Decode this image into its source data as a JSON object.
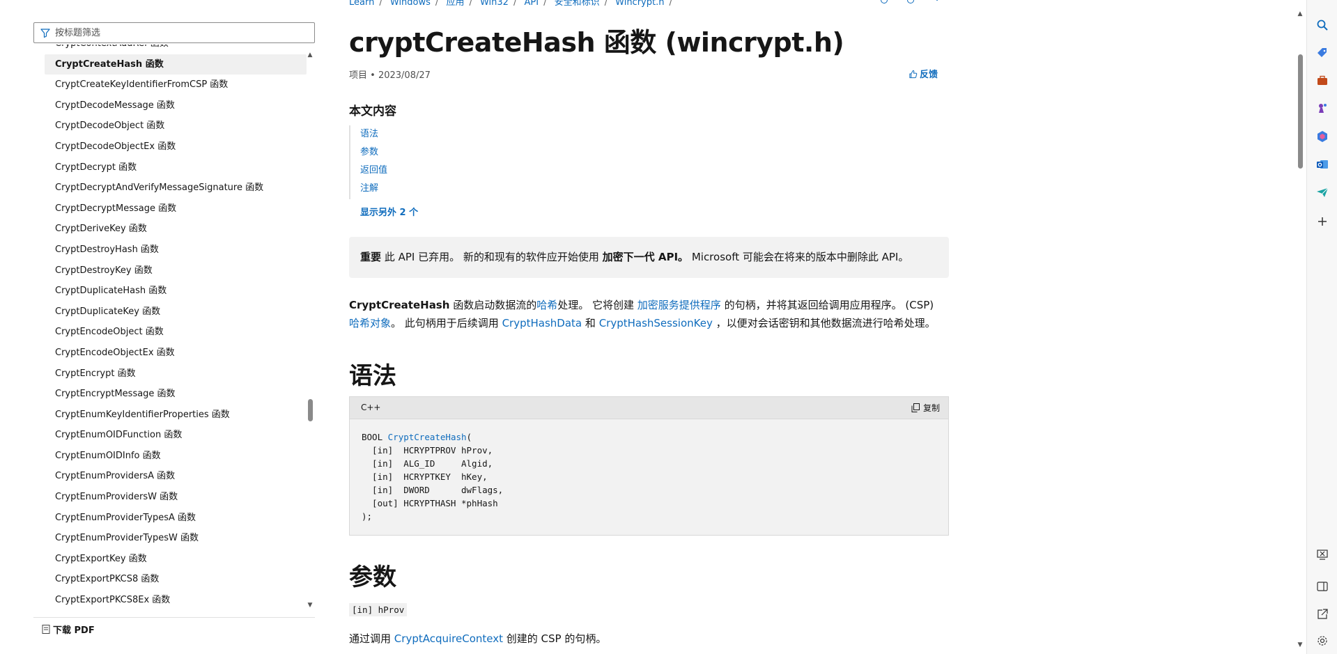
{
  "filter": {
    "placeholder": "按标题筛选"
  },
  "toc_items": [
    "CryptContextAddRef 函数",
    "CryptCreateHash 函数",
    "CryptCreateKeyIdentifierFromCSP 函数",
    "CryptDecodeMessage 函数",
    "CryptDecodeObject 函数",
    "CryptDecodeObjectEx 函数",
    "CryptDecrypt 函数",
    "CryptDecryptAndVerifyMessageSignature 函数",
    "CryptDecryptMessage 函数",
    "CryptDeriveKey 函数",
    "CryptDestroyHash 函数",
    "CryptDestroyKey 函数",
    "CryptDuplicateHash 函数",
    "CryptDuplicateKey 函数",
    "CryptEncodeObject 函数",
    "CryptEncodeObjectEx 函数",
    "CryptEncrypt 函数",
    "CryptEncryptMessage 函数",
    "CryptEnumKeyIdentifierProperties 函数",
    "CryptEnumOIDFunction 函数",
    "CryptEnumOIDInfo 函数",
    "CryptEnumProvidersA 函数",
    "CryptEnumProvidersW 函数",
    "CryptEnumProviderTypesA 函数",
    "CryptEnumProviderTypesW 函数",
    "CryptExportKey 函数",
    "CryptExportPKCS8 函数",
    "CryptExportPKCS8Ex 函数"
  ],
  "toc_active_index": 1,
  "download_pdf": "下载 PDF",
  "breadcrumb": [
    "Learn",
    "Windows",
    "应用",
    "Win32",
    "API",
    "安全和标识",
    "Wincrypt.h"
  ],
  "title": "cryptCreateHash 函数 (wincrypt.h)",
  "meta": {
    "item": "项目",
    "date": "2023/08/27"
  },
  "feedback": "反馈",
  "in_this_article": {
    "heading": "本文内容",
    "links": [
      "语法",
      "参数",
      "返回值",
      "注解"
    ],
    "show_more": "显示另外 2 个"
  },
  "notice": {
    "label": "重要",
    "text1": "此 API 已弃用。 新的和现有的软件应开始使用",
    "link": "加密下一代 API。",
    "text2": "Microsoft 可能会在将来的版本中删除此 API。"
  },
  "intro": {
    "fn": "CryptCreateHash",
    "t1": "函数启动数据流的",
    "l1": "哈希",
    "t2": "处理。 它将创建",
    "l2": "加密服务提供程序",
    "t3": "的句柄，并将其返回给调用应用程序。 (CSP)",
    "l3": "哈希对象",
    "t4": "。 此句柄用于后续调用",
    "l4": "CryptHashData",
    "t5": "和",
    "l5": "CryptHashSessionKey",
    "t6": "，以便对会话密钥和其他数据流进行哈希处理。"
  },
  "syntax": {
    "heading": "语法",
    "lang": "C++",
    "copy": "复制",
    "ret": "BOOL",
    "fn": "CryptCreateHash",
    "open": "(",
    "lines": [
      "  [in]  HCRYPTPROV hProv,",
      "  [in]  ALG_ID     Algid,",
      "  [in]  HCRYPTKEY  hKey,",
      "  [in]  DWORD      dwFlags,",
      "  [out] HCRYPTHASH *phHash",
      ");"
    ]
  },
  "params": {
    "heading": "参数",
    "tag": "[in] hProv",
    "t1": "通过调用",
    "link": "CryptAcquireContext",
    "t2": "创建的 CSP 的句柄。"
  }
}
